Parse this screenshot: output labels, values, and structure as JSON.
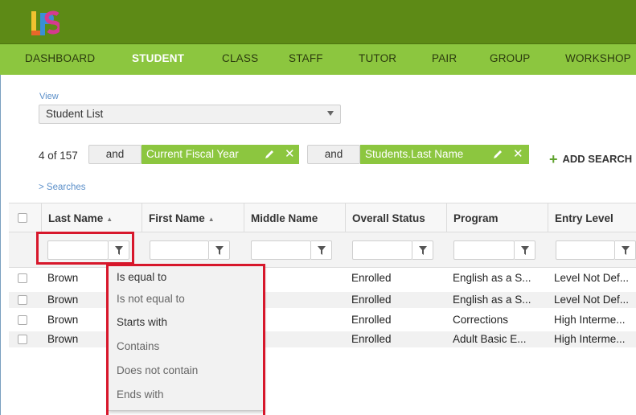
{
  "app": {
    "logo": "LPS logo"
  },
  "nav": {
    "items": [
      "DASHBOARD",
      "STUDENT",
      "CLASS",
      "STAFF",
      "TUTOR",
      "PAIR",
      "GROUP",
      "WORKSHOP"
    ],
    "active": "STUDENT"
  },
  "view": {
    "label": "View",
    "selected": "Student List"
  },
  "search": {
    "count": "4 of 157",
    "and_label": "and",
    "chips": [
      "Current Fiscal Year",
      "Students.Last Name"
    ],
    "add_label": "ADD SEARCH",
    "searches_link": "> Searches"
  },
  "grid": {
    "columns": [
      "Last Name",
      "First Name",
      "Middle Name",
      "Overall Status",
      "Program",
      "Entry Level"
    ],
    "rows": [
      [
        "Brown",
        "",
        "",
        "Enrolled",
        "English as a S...",
        "Level Not Def..."
      ],
      [
        "Brown",
        "",
        "",
        "Enrolled",
        "English as a S...",
        "Level Not Def..."
      ],
      [
        "Brown",
        "",
        "",
        "Enrolled",
        "Corrections",
        "High Interme..."
      ],
      [
        "Brown",
        "",
        "",
        "Enrolled",
        "Adult Basic E...",
        "High Interme..."
      ]
    ]
  },
  "filter_menu": {
    "options": [
      "Is equal to",
      "Is not equal to",
      "Starts with",
      "Contains",
      "Does not contain",
      "Ends with"
    ]
  },
  "colors": {
    "topbar": "#5d8a16",
    "navbar": "#8cc63f",
    "chip": "#8cc63f",
    "highlight": "#d7172b",
    "link": "#5b8fc9"
  }
}
